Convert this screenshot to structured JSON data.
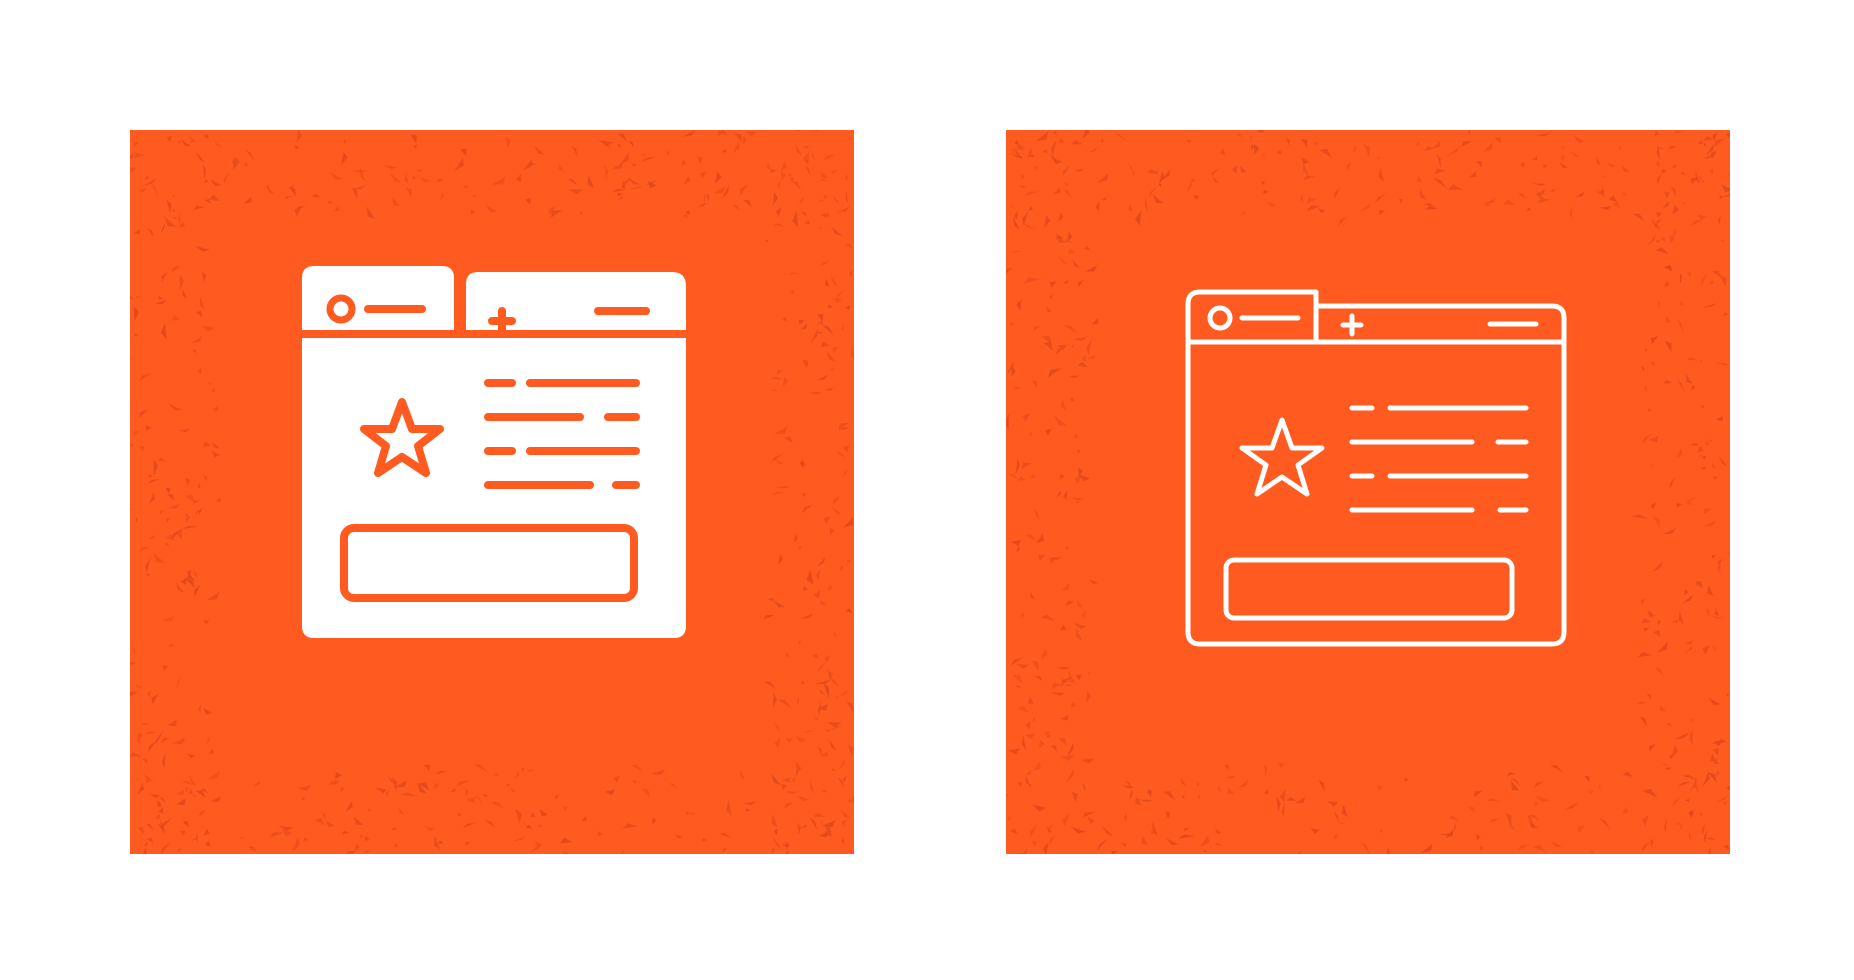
{
  "colors": {
    "page_background": "#ffffff",
    "tile_background": "#ff5a1f",
    "texture": "#e0471b",
    "icon": "#ffffff"
  },
  "icons": [
    {
      "name": "browser-favorite-page-icon",
      "style": "glyph"
    },
    {
      "name": "browser-favorite-page-icon",
      "style": "line"
    }
  ]
}
